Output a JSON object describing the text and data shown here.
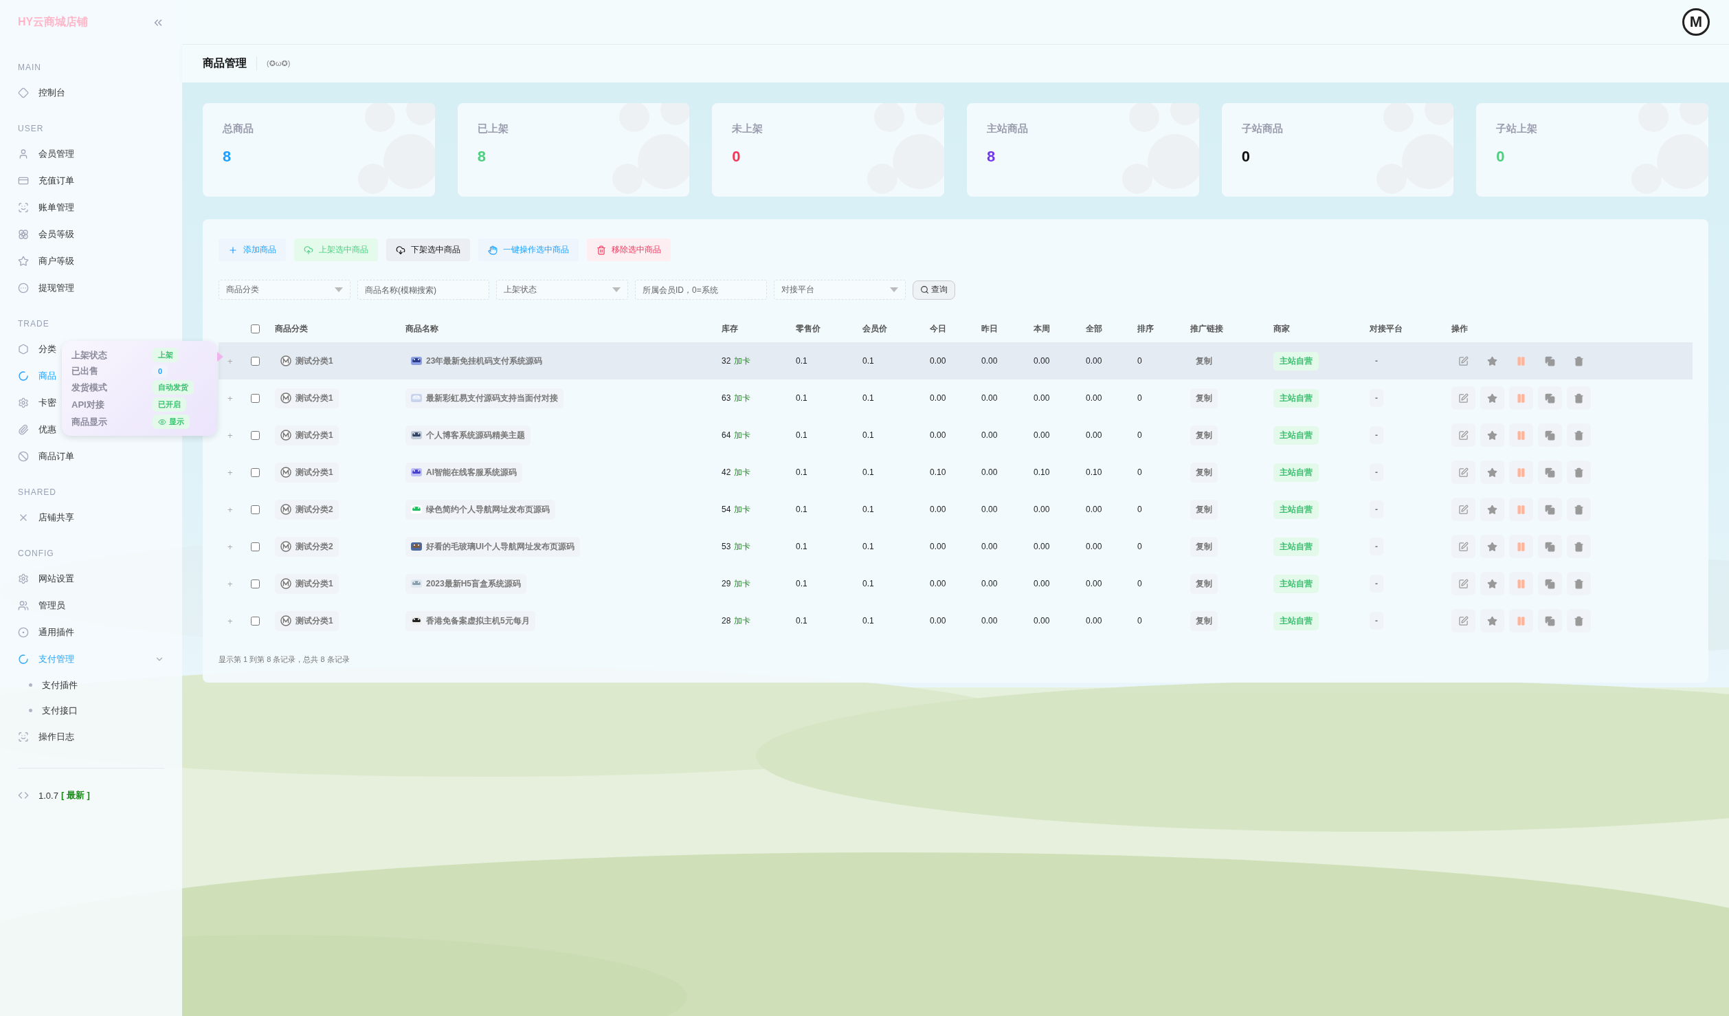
{
  "brand": "HY云商城店铺",
  "avatar": "M",
  "sidebar": {
    "sections": [
      {
        "title": "MAIN",
        "items": [
          {
            "label": "控制台",
            "selected": false
          }
        ]
      },
      {
        "title": "USER",
        "items": [
          {
            "label": "会员管理",
            "selected": false
          },
          {
            "label": "充值订单",
            "selected": false
          },
          {
            "label": "账单管理",
            "selected": false
          },
          {
            "label": "会员等级",
            "selected": false
          },
          {
            "label": "商户等级",
            "selected": false
          },
          {
            "label": "提现管理",
            "selected": false
          }
        ]
      },
      {
        "title": "TRADE",
        "items": [
          {
            "label": "分类",
            "selected": false
          },
          {
            "label": "商品",
            "selected": true
          },
          {
            "label": "卡密",
            "selected": false
          },
          {
            "label": "优惠",
            "selected": false
          },
          {
            "label": "商品订单",
            "selected": false
          }
        ]
      },
      {
        "title": "SHARED",
        "items": [
          {
            "label": "店铺共享",
            "selected": false
          }
        ]
      },
      {
        "title": "CONFIG",
        "items": [
          {
            "label": "网站设置",
            "selected": false
          },
          {
            "label": "管理员",
            "selected": false
          },
          {
            "label": "通用插件",
            "selected": false
          },
          {
            "label": "支付管理",
            "selected": false,
            "expanded": true,
            "children": [
              {
                "label": "支付插件",
                "selected": false
              },
              {
                "label": "支付接口",
                "selected": false
              }
            ]
          },
          {
            "label": "操作日志",
            "selected": false
          }
        ]
      }
    ],
    "version": "1.0.7",
    "version_badge": "[ 最新 ]"
  },
  "popover": [
    {
      "label": "上架状态",
      "value": "上架",
      "kind": "tag"
    },
    {
      "label": "已出售",
      "value": "0",
      "kind": "number"
    },
    {
      "label": "发货模式",
      "value": "自动发货",
      "kind": "tag"
    },
    {
      "label": "API对接",
      "value": "已开启",
      "kind": "tag"
    },
    {
      "label": "商品显示",
      "value": "显示",
      "kind": "eye"
    }
  ],
  "page": {
    "title": "商品管理",
    "emoticon": "(✪ω✪)"
  },
  "stats": [
    {
      "label": "总商品",
      "value": "8",
      "color": "#1e9fff"
    },
    {
      "label": "已上架",
      "value": "8",
      "color": "#4cd080"
    },
    {
      "label": "未上架",
      "value": "0",
      "color": "#f5365c"
    },
    {
      "label": "主站商品",
      "value": "8",
      "color": "#7238e8"
    },
    {
      "label": "子站商品",
      "value": "0",
      "color": "#111111"
    },
    {
      "label": "子站上架",
      "value": "0",
      "color": "#4cd080"
    }
  ],
  "toolbar": [
    {
      "label": "添加商品",
      "kind": "add"
    },
    {
      "label": "上架选中商品",
      "kind": "up"
    },
    {
      "label": "下架选中商品",
      "kind": "down"
    },
    {
      "label": "一键操作选中商品",
      "kind": "batch"
    },
    {
      "label": "移除选中商品",
      "kind": "remove"
    }
  ],
  "filters": [
    {
      "placeholder": "商品分类",
      "kind": "select"
    },
    {
      "placeholder": "商品名称(模糊搜索)",
      "kind": "input"
    },
    {
      "placeholder": "上架状态",
      "kind": "select"
    },
    {
      "placeholder": "所属会员ID，0=系统",
      "kind": "input"
    },
    {
      "placeholder": "对接平台",
      "kind": "select"
    }
  ],
  "search_button": "查询",
  "table": {
    "select_all": false,
    "columns": [
      "商品分类",
      "商品名称",
      "库存",
      "零售价",
      "会员价",
      "今日",
      "昨日",
      "本周",
      "全部",
      "排序",
      "推广链接",
      "商家",
      "对接平台",
      "操作"
    ],
    "rows": [
      {
        "expand": "+",
        "checked": false,
        "highlighted": true,
        "category": "测试分类1",
        "name": "23年最新免挂机码支付系统源码",
        "stock": "32",
        "stock_action": "加卡",
        "retail": "0.1",
        "member": "0.1",
        "today": "0.00",
        "yesterday": "0.00",
        "week": "0.00",
        "total": "0.00",
        "sort": "0",
        "link": "复制",
        "merchant": "主站自营",
        "platform": "-"
      },
      {
        "expand": "+",
        "checked": false,
        "highlighted": false,
        "category": "测试分类1",
        "name": "最新彩虹易支付源码支持当面付对接",
        "stock": "63",
        "stock_action": "加卡",
        "retail": "0.1",
        "member": "0.1",
        "today": "0.00",
        "yesterday": "0.00",
        "week": "0.00",
        "total": "0.00",
        "sort": "0",
        "link": "复制",
        "merchant": "主站自营",
        "platform": "-"
      },
      {
        "expand": "+",
        "checked": false,
        "highlighted": false,
        "category": "测试分类1",
        "name": "个人博客系统源码精美主题",
        "stock": "64",
        "stock_action": "加卡",
        "retail": "0.1",
        "member": "0.1",
        "today": "0.00",
        "yesterday": "0.00",
        "week": "0.00",
        "total": "0.00",
        "sort": "0",
        "link": "复制",
        "merchant": "主站自营",
        "platform": "-"
      },
      {
        "expand": "+",
        "checked": false,
        "highlighted": false,
        "category": "测试分类1",
        "name": "AI智能在线客服系统源码",
        "stock": "42",
        "stock_action": "加卡",
        "retail": "0.1",
        "member": "0.1",
        "today": "0.10",
        "yesterday": "0.00",
        "week": "0.10",
        "total": "0.10",
        "sort": "0",
        "link": "复制",
        "merchant": "主站自营",
        "platform": "-"
      },
      {
        "expand": "+",
        "checked": false,
        "highlighted": false,
        "category": "测试分类2",
        "name": "绿色简约个人导航网址发布页源码",
        "stock": "54",
        "stock_action": "加卡",
        "retail": "0.1",
        "member": "0.1",
        "today": "0.00",
        "yesterday": "0.00",
        "week": "0.00",
        "total": "0.00",
        "sort": "0",
        "link": "复制",
        "merchant": "主站自营",
        "platform": "-"
      },
      {
        "expand": "+",
        "checked": false,
        "highlighted": false,
        "category": "测试分类2",
        "name": "好看的毛玻璃UI个人导航网址发布页源码",
        "stock": "53",
        "stock_action": "加卡",
        "retail": "0.1",
        "member": "0.1",
        "today": "0.00",
        "yesterday": "0.00",
        "week": "0.00",
        "total": "0.00",
        "sort": "0",
        "link": "复制",
        "merchant": "主站自营",
        "platform": "-"
      },
      {
        "expand": "+",
        "checked": false,
        "highlighted": false,
        "category": "测试分类1",
        "name": "2023最新H5盲盒系统源码",
        "stock": "29",
        "stock_action": "加卡",
        "retail": "0.1",
        "member": "0.1",
        "today": "0.00",
        "yesterday": "0.00",
        "week": "0.00",
        "total": "0.00",
        "sort": "0",
        "link": "复制",
        "merchant": "主站自营",
        "platform": "-"
      },
      {
        "expand": "+",
        "checked": false,
        "highlighted": false,
        "category": "测试分类1",
        "name": "香港免备案虚拟主机5元每月",
        "stock": "28",
        "stock_action": "加卡",
        "retail": "0.1",
        "member": "0.1",
        "today": "0.00",
        "yesterday": "0.00",
        "week": "0.00",
        "total": "0.00",
        "sort": "0",
        "link": "复制",
        "merchant": "主站自营",
        "platform": "-"
      }
    ]
  },
  "footer": "显示第 1 到第 8 条记录，总共 8 条记录"
}
